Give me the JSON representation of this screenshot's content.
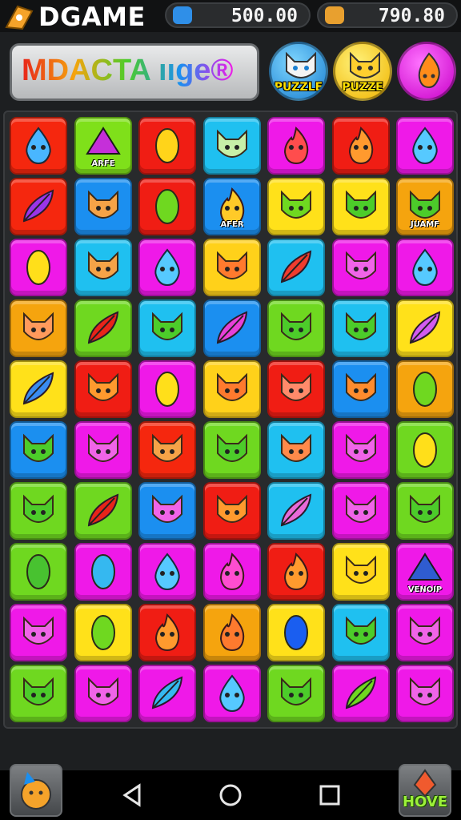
{
  "app": {
    "title": "DGAME"
  },
  "counters": [
    {
      "value": "500.00",
      "icon": "gem-icon",
      "color": "#2f8fe8"
    },
    {
      "value": "790.80",
      "icon": "gift-icon",
      "color": "#e8a02f"
    }
  ],
  "banner": {
    "text": "MDACTA ııge®"
  },
  "header_buttons": [
    {
      "label": "PUZZLE",
      "icon": "white-cat-icon",
      "face": "#f4f4f4"
    },
    {
      "label": "PUZZE",
      "icon": "yellow-cat-icon",
      "face": "#ffcf2e"
    },
    {
      "label": "",
      "icon": "flame-icon",
      "face": "#ff8c1a"
    }
  ],
  "board": {
    "rows": 10,
    "cols": 7,
    "tiles": [
      [
        {
          "bg": "#f5270e",
          "piece": "drop",
          "pc": "#49b6ff"
        },
        {
          "bg": "#7fe01a",
          "piece": "tent",
          "pc": "#c52fd9",
          "label": "ARFE"
        },
        {
          "bg": "#f01d14",
          "piece": "leaf",
          "pc": "#ffd41a"
        },
        {
          "bg": "#1fc0f0",
          "piece": "cat",
          "pc": "#c7f0a8"
        },
        {
          "bg": "#ef19e8",
          "piece": "flame",
          "pc": "#ff4d4d"
        },
        {
          "bg": "#f01d14",
          "piece": "flame",
          "pc": "#ff9a2e"
        },
        {
          "bg": "#ef19e8",
          "piece": "drop",
          "pc": "#56c9ff"
        }
      ],
      [
        {
          "bg": "#f5270e",
          "piece": "feather",
          "pc": "#9a35e8"
        },
        {
          "bg": "#1b8ff0",
          "piece": "cat",
          "pc": "#f5a347"
        },
        {
          "bg": "#f01d14",
          "piece": "leaf",
          "pc": "#6fd820"
        },
        {
          "bg": "#1b8ff0",
          "piece": "flame",
          "pc": "#ffca28",
          "label": "AFER"
        },
        {
          "bg": "#ffe11a",
          "piece": "cat",
          "pc": "#6fd820"
        },
        {
          "bg": "#ffe11a",
          "piece": "cat",
          "pc": "#4ccc2a"
        },
        {
          "bg": "#f5a40e",
          "piece": "cat",
          "pc": "#4ccc2a",
          "label": "JUAMF"
        }
      ],
      [
        {
          "bg": "#ef19e8",
          "piece": "leaf",
          "pc": "#ffdf1a"
        },
        {
          "bg": "#1fc0f0",
          "piece": "cat",
          "pc": "#f5a347"
        },
        {
          "bg": "#ef19e8",
          "piece": "drop",
          "pc": "#56c9ff"
        },
        {
          "bg": "#ffd11a",
          "piece": "cat",
          "pc": "#ff7a2e"
        },
        {
          "bg": "#1fc0f0",
          "piece": "feather",
          "pc": "#f03c2e"
        },
        {
          "bg": "#ef19e8",
          "piece": "cat",
          "pc": "#f064e8"
        },
        {
          "bg": "#ef19e8",
          "piece": "drop",
          "pc": "#56c9ff"
        }
      ],
      [
        {
          "bg": "#f5a40e",
          "piece": "cat",
          "pc": "#ff9a5c"
        },
        {
          "bg": "#6fd820",
          "piece": "feather",
          "pc": "#e8241a"
        },
        {
          "bg": "#1fc0f0",
          "piece": "cat",
          "pc": "#4ccc2a"
        },
        {
          "bg": "#1b8ff0",
          "piece": "feather",
          "pc": "#e840d8"
        },
        {
          "bg": "#6fd820",
          "piece": "cat",
          "pc": "#4ccc2a"
        },
        {
          "bg": "#1fc0f0",
          "piece": "cat",
          "pc": "#4ccc2a"
        },
        {
          "bg": "#ffe11a",
          "piece": "feather",
          "pc": "#d25cf0"
        }
      ],
      [
        {
          "bg": "#ffe11a",
          "piece": "feather",
          "pc": "#3a8cf0"
        },
        {
          "bg": "#f01d14",
          "piece": "cat",
          "pc": "#ff9a2e"
        },
        {
          "bg": "#ef19e8",
          "piece": "leaf",
          "pc": "#ffdf1a"
        },
        {
          "bg": "#ffd11a",
          "piece": "cat",
          "pc": "#ff7a2e"
        },
        {
          "bg": "#f01d14",
          "piece": "cat",
          "pc": "#ff8a6a"
        },
        {
          "bg": "#1b8ff0",
          "piece": "cat",
          "pc": "#ff8c2e"
        },
        {
          "bg": "#f5a40e",
          "piece": "leaf",
          "pc": "#6fd820"
        }
      ],
      [
        {
          "bg": "#1b8ff0",
          "piece": "cat",
          "pc": "#4ccc2a"
        },
        {
          "bg": "#ef19e8",
          "piece": "cat",
          "pc": "#f064e8"
        },
        {
          "bg": "#f5270e",
          "piece": "cat",
          "pc": "#f5a347"
        },
        {
          "bg": "#6fd820",
          "piece": "cat",
          "pc": "#4ccc2a"
        },
        {
          "bg": "#1fc0f0",
          "piece": "cat",
          "pc": "#ff8a4a"
        },
        {
          "bg": "#ef19e8",
          "piece": "cat",
          "pc": "#f064e8"
        },
        {
          "bg": "#6fd820",
          "piece": "leaf",
          "pc": "#ffdf1a"
        }
      ],
      [
        {
          "bg": "#6fd820",
          "piece": "cat",
          "pc": "#4ccc2a"
        },
        {
          "bg": "#6fd820",
          "piece": "feather",
          "pc": "#e8241a"
        },
        {
          "bg": "#1b8ff0",
          "piece": "cat",
          "pc": "#f064e8"
        },
        {
          "bg": "#f01d14",
          "piece": "cat",
          "pc": "#ff9a2e"
        },
        {
          "bg": "#1fc0f0",
          "piece": "feather",
          "pc": "#e86ad8"
        },
        {
          "bg": "#ef19e8",
          "piece": "cat",
          "pc": "#f064e8"
        },
        {
          "bg": "#6fd820",
          "piece": "cat",
          "pc": "#4ccc2a"
        }
      ],
      [
        {
          "bg": "#6fd820",
          "piece": "leaf",
          "pc": "#48c230"
        },
        {
          "bg": "#ef19e8",
          "piece": "leaf",
          "pc": "#35b8f0"
        },
        {
          "bg": "#ef19e8",
          "piece": "drop",
          "pc": "#56c9ff"
        },
        {
          "bg": "#ef19e8",
          "piece": "flame",
          "pc": "#ff4dd0"
        },
        {
          "bg": "#f01d14",
          "piece": "flame",
          "pc": "#ff9a2e"
        },
        {
          "bg": "#ffe11a",
          "piece": "cat",
          "pc": "#ffd11a"
        },
        {
          "bg": "#ef19e8",
          "piece": "tent",
          "pc": "#2f5cd0",
          "label": "VENOIP"
        }
      ],
      [
        {
          "bg": "#ef19e8",
          "piece": "cat",
          "pc": "#f064e8"
        },
        {
          "bg": "#ffe11a",
          "piece": "leaf",
          "pc": "#6fd820"
        },
        {
          "bg": "#f01d14",
          "piece": "flame",
          "pc": "#ff9a2e"
        },
        {
          "bg": "#f5a40e",
          "piece": "flame",
          "pc": "#ff7a2e"
        },
        {
          "bg": "#ffe11a",
          "piece": "leaf",
          "pc": "#1a5ef0"
        },
        {
          "bg": "#1fc0f0",
          "piece": "cat",
          "pc": "#4ccc2a"
        },
        {
          "bg": "#ef19e8",
          "piece": "cat",
          "pc": "#f064e8"
        }
      ],
      [
        {
          "bg": "#6fd820",
          "piece": "cat",
          "pc": "#4ccc2a"
        },
        {
          "bg": "#ef19e8",
          "piece": "cat",
          "pc": "#f064e8"
        },
        {
          "bg": "#ef19e8",
          "piece": "feather",
          "pc": "#35b8f0"
        },
        {
          "bg": "#ef19e8",
          "piece": "drop",
          "pc": "#56c9ff"
        },
        {
          "bg": "#6fd820",
          "piece": "cat",
          "pc": "#4ccc2a"
        },
        {
          "bg": "#ef19e8",
          "piece": "feather",
          "pc": "#6fd820"
        },
        {
          "bg": "#ef19e8",
          "piece": "cat",
          "pc": "#f064e8"
        }
      ]
    ]
  },
  "bottom": {
    "left_button_icon": "fox-icon",
    "right_button_label": "HOVE",
    "nav": [
      "back-icon",
      "home-icon",
      "recents-icon"
    ]
  }
}
